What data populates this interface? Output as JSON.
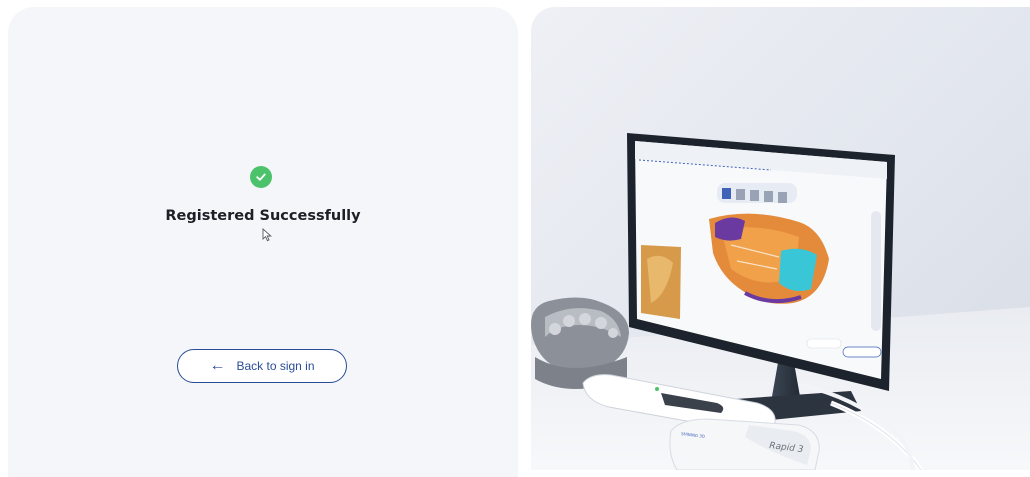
{
  "status": {
    "icon": "check-circle-icon",
    "title": "Registered Successfully"
  },
  "back_button": {
    "icon": "arrow-left-icon",
    "label": "Back to sign in"
  },
  "hero": {
    "device_label": "Rapid 3"
  },
  "colors": {
    "success": "#4cc26b",
    "accent": "#2b4d96",
    "panel_bg": "#f4f6f9"
  }
}
